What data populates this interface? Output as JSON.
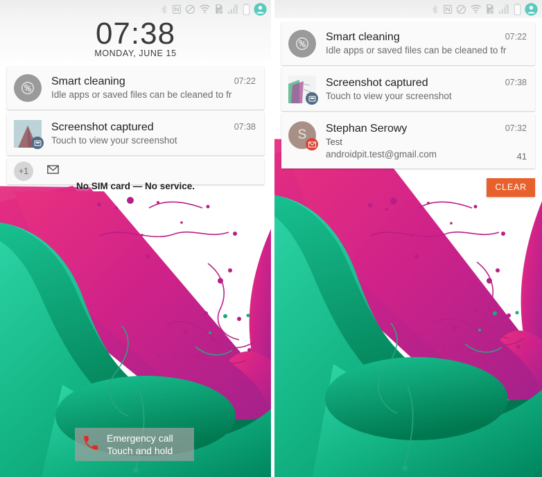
{
  "meta": {
    "scene": "android-lockscreen-notifications-comparison",
    "panel_count": 2
  },
  "colors": {
    "accent_clear_button": "#e8602c",
    "wallpaper_magenta": "#c0278c",
    "wallpaper_pink": "#e8307f",
    "wallpaper_green": "#00a878",
    "wallpaper_teal": "#1fc79a",
    "status_icon": "#b9bfc0",
    "avatar_teal": "#52c8bd",
    "gmail_red": "#db4437",
    "notification_background": "#fafafa",
    "emergency_scrim": "rgba(160,160,160,0.72)"
  },
  "status_bar": {
    "icons": [
      {
        "name": "bluetooth-icon",
        "label": "Bluetooth"
      },
      {
        "name": "nfc-icon",
        "label": "NFC"
      },
      {
        "name": "do-not-disturb-icon",
        "label": "Do not disturb"
      },
      {
        "name": "wifi-icon",
        "label": "Wi-Fi"
      },
      {
        "name": "no-sim-card-icon",
        "label": "No SIM card"
      },
      {
        "name": "signal-bars-icon",
        "label": "No signal"
      },
      {
        "name": "battery-icon",
        "label": "Battery"
      },
      {
        "name": "user-profile-icon",
        "label": "User"
      }
    ]
  },
  "left_panel": {
    "name": "lockscreen-with-collapsed-notifications",
    "clock": {
      "time": "07:38",
      "date": "MONDAY, JUNE 15"
    },
    "notifications": [
      {
        "id": "smart-cleaning",
        "icon": "percent-circle-icon",
        "title": "Smart cleaning",
        "text": "Idle apps or saved files can be cleaned to fr",
        "time": "07:22"
      },
      {
        "id": "screenshot-captured",
        "icon": "screenshot-thumbnail",
        "title": "Screenshot captured",
        "text": "Touch to view your screenshot",
        "time": "07:38"
      }
    ],
    "collapsed_row": {
      "count_label": "+1",
      "icons": [
        {
          "name": "gmail-envelope-icon",
          "label": "Gmail"
        }
      ]
    },
    "sim_status": "No SIM card — No service.",
    "emergency_call": {
      "line1": "Emergency call",
      "line2": "Touch and hold",
      "icon": "phone-handset-icon"
    }
  },
  "right_panel": {
    "name": "lockscreen-with-expanded-notifications",
    "notifications": [
      {
        "id": "smart-cleaning",
        "icon": "percent-circle-icon",
        "title": "Smart cleaning",
        "text": "Idle apps or saved files can be cleaned to fr",
        "time": "07:22"
      },
      {
        "id": "screenshot-captured",
        "icon": "screenshot-thumbnail",
        "title": "Screenshot captured",
        "text": "Touch to view your screenshot",
        "time": "07:38"
      },
      {
        "id": "gmail-message",
        "icon": "avatar-initial",
        "avatar_initial": "S",
        "title": "Stephan Serowy",
        "text": "Test",
        "subtext": "androidpit.test@gmail.com",
        "time": "07:32",
        "count": "41"
      }
    ],
    "clear_button": "CLEAR"
  }
}
